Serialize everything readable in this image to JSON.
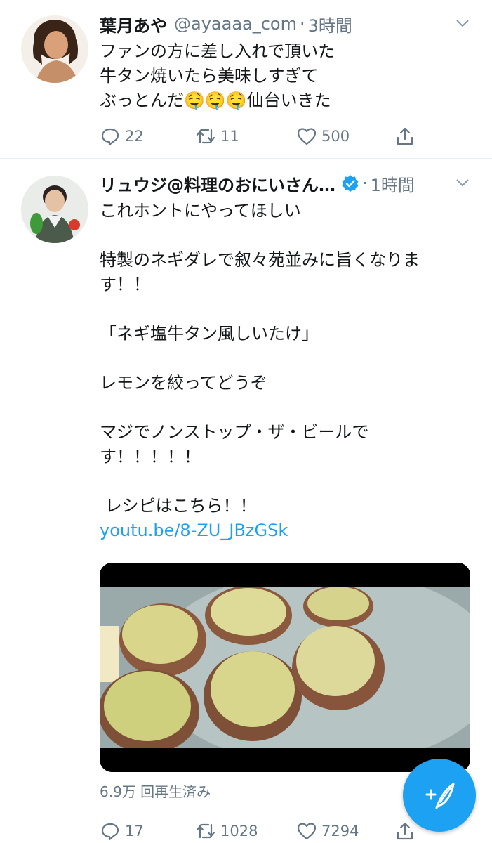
{
  "tweets": [
    {
      "name": "葉月あや",
      "handle": "@ayaaaa_com",
      "dot": "·",
      "time": "3時間",
      "text": "ファンの方に差し入れで頂いた\n牛タン焼いたら美味しすぎて\nぶっとんだ🤤🤤🤤仙台いきた",
      "replies": "22",
      "retweets": "11",
      "likes": "500"
    },
    {
      "name": "リュウジ@料理のおにいさん…",
      "dot": "·",
      "time": "1時間",
      "text": "これホントにやってほしい\n\n特製のネギダレで叙々苑並みに旨くなりま\nす！！\n\n「ネギ塩牛タン風しいたけ」\n\nレモンを絞ってどうぞ\n\nマジでノンストップ・ザ・ビールで\nす！！！！！\n\n レシピはこちら！！",
      "link": "youtu.be/8-ZU_JBzGSk",
      "views": "6.9万 回再生済み",
      "replies": "17",
      "retweets": "1028",
      "likes": "7294"
    }
  ],
  "colors": {
    "accent": "#1da1f2",
    "secondary_text": "#657786",
    "divider": "#e6ecf0"
  },
  "icons": [
    "reply-icon",
    "retweet-icon",
    "like-icon",
    "share-icon",
    "verified-icon",
    "chevron-down-icon",
    "compose-icon"
  ]
}
